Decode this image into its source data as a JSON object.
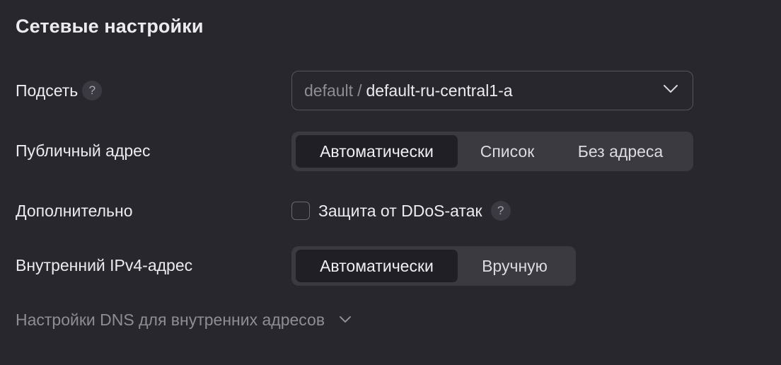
{
  "section": {
    "title": "Сетевые настройки"
  },
  "subnet": {
    "label": "Подсеть",
    "help_icon": "?",
    "folder": "default",
    "separator": "/",
    "value": "default-ru-central1-a",
    "chevron_icon": "chevron-down-icon"
  },
  "public_address": {
    "label": "Публичный адрес",
    "options": [
      "Автоматически",
      "Список",
      "Без адреса"
    ],
    "selected": "Автоматически"
  },
  "additional": {
    "label": "Дополнительно",
    "ddos_label": "Защита от DDoS-атак",
    "ddos_checked": false,
    "help_icon": "?"
  },
  "internal_ipv4": {
    "label": "Внутренний IPv4-адрес",
    "options": [
      "Автоматически",
      "Вручную"
    ],
    "selected": "Автоматически"
  },
  "dns": {
    "label": "Настройки DNS для внутренних адресов",
    "chevron_icon": "chevron-down-icon"
  },
  "colors": {
    "background": "#28272d",
    "segment_bg": "#3b3a41",
    "segment_active": "#201f25",
    "muted_text": "#8e8d94",
    "text": "#ececef"
  }
}
